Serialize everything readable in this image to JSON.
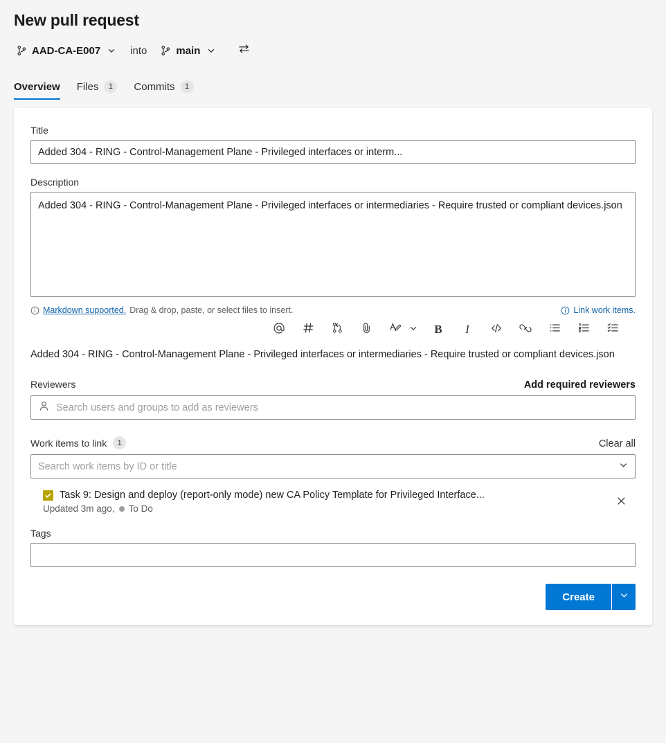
{
  "header": {
    "title": "New pull request",
    "source_branch": "AAD-CA-E007",
    "into_label": "into",
    "target_branch": "main",
    "swap_icon": "swap-arrows-icon",
    "branch_icon": "git-branch-icon"
  },
  "tabs": [
    {
      "label": "Overview",
      "count": "",
      "active": true
    },
    {
      "label": "Files",
      "count": "1",
      "active": false
    },
    {
      "label": "Commits",
      "count": "1",
      "active": false
    }
  ],
  "form": {
    "title_label": "Title",
    "title_value": "Added 304 - RING - Control-Management Plane - Privileged interfaces or interm...",
    "description_label": "Description",
    "description_value": "Added 304 - RING - Control-Management Plane - Privileged interfaces or intermediaries - Require trusted or compliant devices.json",
    "hint_link": "Markdown supported.",
    "hint_text": "Drag & drop, paste, or select files to insert.",
    "link_work_items": "Link work items.",
    "preview_text": "Added 304 - RING - Control-Management Plane - Privileged interfaces or intermediaries - Require trusted or compliant devices.json"
  },
  "toolbar": [
    {
      "name": "mention-icon",
      "glyph": "@"
    },
    {
      "name": "hash-work-item-icon",
      "glyph": "#"
    },
    {
      "name": "pull-request-icon",
      "glyph": ""
    },
    {
      "name": "attachment-icon",
      "glyph": ""
    },
    {
      "name": "highlight-icon",
      "glyph": ""
    },
    {
      "name": "chevron-down-icon",
      "glyph": ""
    },
    {
      "name": "bold-icon",
      "glyph": "B"
    },
    {
      "name": "italic-icon",
      "glyph": "I"
    },
    {
      "name": "code-icon",
      "glyph": "</>"
    },
    {
      "name": "link-icon",
      "glyph": ""
    },
    {
      "name": "bullet-list-icon",
      "glyph": ""
    },
    {
      "name": "numbered-list-icon",
      "glyph": ""
    },
    {
      "name": "task-list-icon",
      "glyph": ""
    }
  ],
  "reviewers": {
    "label": "Reviewers",
    "action": "Add required reviewers",
    "placeholder": "Search users and groups to add as reviewers",
    "lead_icon": "person-icon"
  },
  "work_items": {
    "label": "Work items to link",
    "count": "1",
    "clear_all": "Clear all",
    "placeholder": "Search work items by ID or title",
    "items": [
      {
        "type_icon": "task-checkbox-icon",
        "title": "Task 9: Design and deploy (report-only mode) new CA Policy Template for Privileged Interface...",
        "updated": "Updated 3m ago,",
        "state": "To Do",
        "remove_icon": "close-icon"
      }
    ]
  },
  "tags": {
    "label": "Tags",
    "value": "",
    "placeholder": ""
  },
  "footer": {
    "create_label": "Create",
    "create_chevron": "chevron-down-icon"
  },
  "colors": {
    "accent": "#0078d4",
    "link": "#0e62a8",
    "task_icon": "#b8a400",
    "page_bg": "#f5f5f5",
    "card_bg": "#ffffff"
  }
}
